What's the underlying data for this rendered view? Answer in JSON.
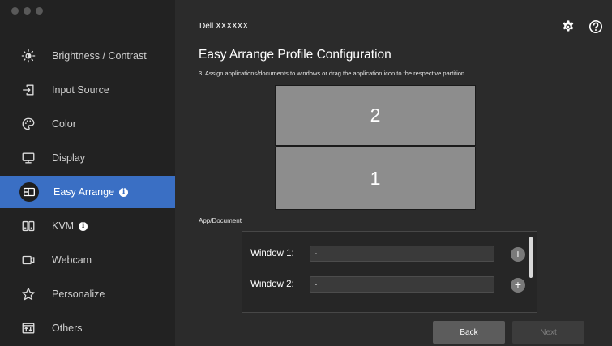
{
  "window": {
    "traffic_lights": [
      "#595959",
      "#595959",
      "#595959"
    ]
  },
  "header": {
    "device_name": "Dell XXXXXX",
    "settings_icon": "gear-icon",
    "help_icon": "question-circle-icon"
  },
  "sidebar": {
    "items": [
      {
        "label": "Brightness / Contrast",
        "icon": "sun-icon",
        "info": false,
        "active": false
      },
      {
        "label": "Input Source",
        "icon": "input-arrow-icon",
        "info": false,
        "active": false
      },
      {
        "label": "Color",
        "icon": "palette-icon",
        "info": false,
        "active": false
      },
      {
        "label": "Display",
        "icon": "monitor-icon",
        "info": false,
        "active": false
      },
      {
        "label": "Easy Arrange",
        "icon": "layout-icon",
        "info": true,
        "active": true
      },
      {
        "label": "KVM",
        "icon": "kvm-icon",
        "info": true,
        "active": false
      },
      {
        "label": "Webcam",
        "icon": "camera-icon",
        "info": false,
        "active": false
      },
      {
        "label": "Personalize",
        "icon": "star-icon",
        "info": false,
        "active": false
      },
      {
        "label": "Others",
        "icon": "others-icon",
        "info": false,
        "active": false
      }
    ],
    "active_color": "#3a6fc4"
  },
  "main": {
    "title": "Easy Arrange Profile Configuration",
    "instruction": "3. Assign applications/documents to windows or drag the application icon to the respective partition",
    "partitions": {
      "top": "2",
      "bottom": "1"
    },
    "section_label": "App/Document",
    "windows": [
      {
        "label": "Window 1:",
        "value": "-"
      },
      {
        "label": "Window 2:",
        "value": "-"
      }
    ],
    "add_symbol": "+",
    "back_label": "Back",
    "next_label": "Next"
  }
}
